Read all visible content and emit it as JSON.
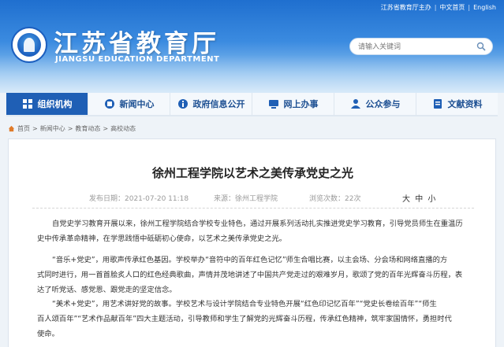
{
  "toplinks": [
    "江苏省教育厅主办",
    "中文首页",
    "English"
  ],
  "site": {
    "title": "江苏省教育厅",
    "subtitle": "JIANGSU EDUCATION DEPARTMENT"
  },
  "search": {
    "placeholder": "请输入关键词"
  },
  "nav": [
    {
      "label": "组织机构",
      "icon": "org-icon"
    },
    {
      "label": "新闻中心",
      "icon": "news-icon"
    },
    {
      "label": "政府信息公开",
      "icon": "info-icon"
    },
    {
      "label": "网上办事",
      "icon": "service-icon"
    },
    {
      "label": "公众参与",
      "icon": "people-icon"
    },
    {
      "label": "文献资料",
      "icon": "book-icon"
    }
  ],
  "breadcrumb": [
    "首页",
    "新闻中心",
    "教育动态",
    "高校动态"
  ],
  "article": {
    "title": "徐州工程学院以艺术之美传承党史之光",
    "meta": {
      "published": "发布日期：2021-07-20 11:18",
      "source": "来源：徐州工程学院",
      "views": "浏览次数：22次"
    },
    "font_sizes": [
      "大",
      "中",
      "小"
    ],
    "paragraphs": [
      [
        "自党史学习教育开展以来，徐州工程学院结合学校专业特色，通过开展系列活动扎实推进党史学习教育，引导党员师生在重温历",
        "史中传承革命精神，在学思践悟中砥砺初心使命，以艺术之美传承党史之光。"
      ],
      [
        "“音乐+党史”，用歌声传承红色基因。学校举办“音符中的百年红色记忆”师生合唱比赛，以主会场、分会场和网络直播的方",
        "式同时进行，用一首首脍炙人口的红色经典歌曲，声情并茂地讲述了中国共产党走过的艰难岁月，歌颂了党的百年光辉奋斗历程，表",
        "达了听党话、感党恩、跟党走的坚定信念。"
      ],
      [
        "“美术+党史”，用艺术讲好党的故事。学校艺术与设计学院结合专业特色开展“红色印记忆百年”“党史长卷绘百年”“师生",
        "百人颂百年”“艺术作品献百年”四大主题活动，引导教师和学生了解党的光辉奋斗历程，传承红色精神，筑牢家国情怀，勇担时代",
        "使命。"
      ]
    ]
  },
  "colors": {
    "header_blue": "#1f6fcf",
    "nav_active": "#1f5fb5",
    "nav_text": "#1c4f92"
  }
}
